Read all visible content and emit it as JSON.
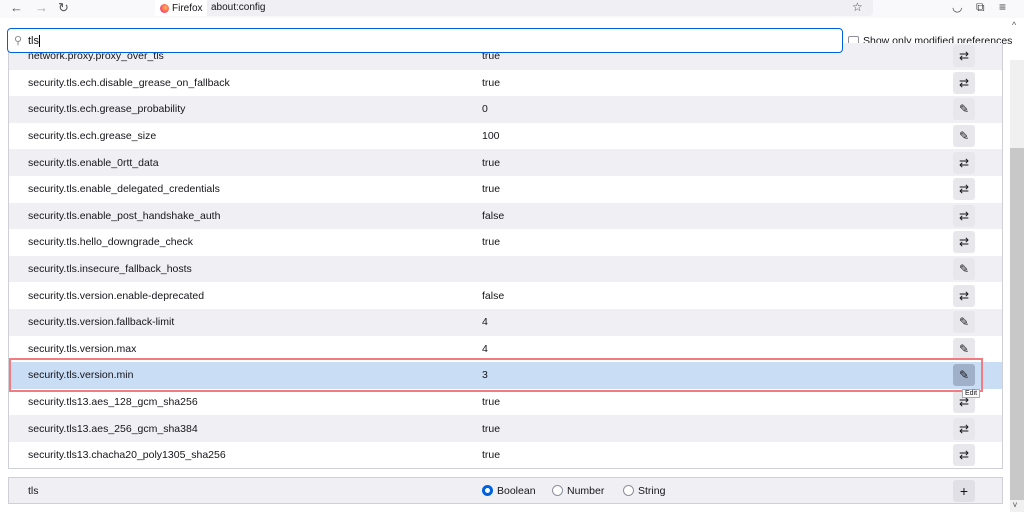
{
  "browser": {
    "tab_title": "Firefox",
    "url": "about:config",
    "back_icon": "arrow-left",
    "forward_icon": "arrow-right",
    "reload_icon": "reload",
    "bookmark_icon": "star",
    "pocket_icon": "pocket",
    "extensions_icon": "puzzle",
    "menu_icon": "hamburger"
  },
  "search": {
    "value": "tls"
  },
  "show_modified_label": "Show only modified preferences",
  "show_modified_checked": false,
  "prefs": [
    {
      "name": "network.proxy.proxy_over_tls",
      "value": "true",
      "action": "toggle"
    },
    {
      "name": "security.tls.ech.disable_grease_on_fallback",
      "value": "true",
      "action": "toggle"
    },
    {
      "name": "security.tls.ech.grease_probability",
      "value": "0",
      "action": "edit"
    },
    {
      "name": "security.tls.ech.grease_size",
      "value": "100",
      "action": "edit"
    },
    {
      "name": "security.tls.enable_0rtt_data",
      "value": "true",
      "action": "toggle"
    },
    {
      "name": "security.tls.enable_delegated_credentials",
      "value": "true",
      "action": "toggle"
    },
    {
      "name": "security.tls.enable_post_handshake_auth",
      "value": "false",
      "action": "toggle"
    },
    {
      "name": "security.tls.hello_downgrade_check",
      "value": "true",
      "action": "toggle"
    },
    {
      "name": "security.tls.insecure_fallback_hosts",
      "value": "",
      "action": "edit"
    },
    {
      "name": "security.tls.version.enable-deprecated",
      "value": "false",
      "action": "toggle"
    },
    {
      "name": "security.tls.version.fallback-limit",
      "value": "4",
      "action": "edit"
    },
    {
      "name": "security.tls.version.max",
      "value": "4",
      "action": "edit"
    },
    {
      "name": "security.tls.version.min",
      "value": "3",
      "action": "edit",
      "selected": true
    },
    {
      "name": "security.tls13.aes_128_gcm_sha256",
      "value": "true",
      "action": "toggle"
    },
    {
      "name": "security.tls13.aes_256_gcm_sha384",
      "value": "true",
      "action": "toggle"
    },
    {
      "name": "security.tls13.chacha20_poly1305_sha256",
      "value": "true",
      "action": "toggle"
    }
  ],
  "tooltip": "Edit",
  "add_row": {
    "name": "tls",
    "types": [
      "Boolean",
      "Number",
      "String"
    ],
    "selected_type": "Boolean",
    "add_icon": "plus"
  },
  "colors": {
    "accent": "#0061e0",
    "selected_row": "#c9ddf5",
    "highlight_box": "#f07b80"
  }
}
